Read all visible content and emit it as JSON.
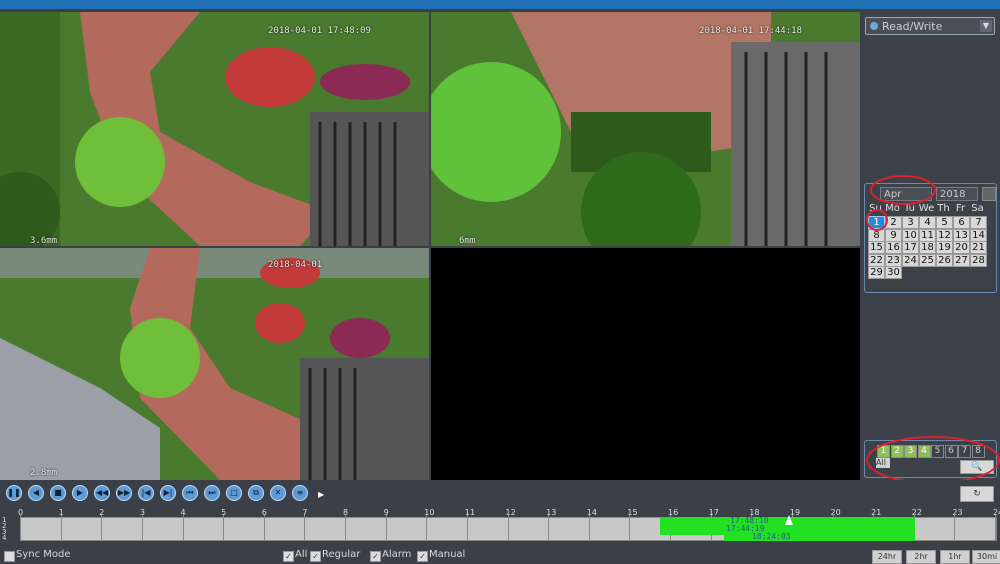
{
  "cameras": [
    {
      "id": "cam1",
      "timestamp": "2018-04-01 17:48:09",
      "lens": "3.6mm"
    },
    {
      "id": "cam2",
      "timestamp": "2018-04-01 17:44:18",
      "lens": "6mm"
    },
    {
      "id": "cam3",
      "timestamp": "2018-04-01",
      "lens": "2.8mm"
    }
  ],
  "mode": {
    "value": "Read/Write"
  },
  "calendar": {
    "month": "Apr",
    "year": "2018",
    "days_of_week": [
      "Su",
      "Mo",
      "Tu",
      "We",
      "Th",
      "Fr",
      "Sa"
    ],
    "days": [
      "1",
      "2",
      "3",
      "4",
      "5",
      "6",
      "7",
      "8",
      "9",
      "10",
      "11",
      "12",
      "13",
      "14",
      "15",
      "16",
      "17",
      "18",
      "19",
      "20",
      "21",
      "22",
      "23",
      "24",
      "25",
      "26",
      "27",
      "28",
      "29",
      "30"
    ],
    "selected_day": "1"
  },
  "channels": {
    "items": [
      "1",
      "2",
      "3",
      "4",
      "5",
      "6",
      "7",
      "8"
    ],
    "enabled": [
      "1",
      "2",
      "3",
      "4"
    ],
    "all_label": "All"
  },
  "playback_buttons": [
    "pause-icon",
    "rewind-icon",
    "stop-icon",
    "play-icon",
    "slow-icon",
    "fast-icon",
    "prev-frame-icon",
    "next-frame-icon",
    "prev-file-icon",
    "next-file-icon",
    "clip-icon",
    "backup-icon",
    "fullscreen-icon",
    "list-icon"
  ],
  "timeline": {
    "hours": [
      "0",
      "1",
      "2",
      "3",
      "4",
      "5",
      "6",
      "7",
      "8",
      "9",
      "10",
      "11",
      "12",
      "13",
      "14",
      "15",
      "16",
      "17",
      "18",
      "19",
      "20",
      "21",
      "22",
      "23",
      "24"
    ],
    "channel_labels": [
      "1",
      "2",
      "3",
      "4"
    ],
    "record_labels": [
      "17:48:10",
      "17:44:19",
      "18:24:03"
    ]
  },
  "options": {
    "sync_mode": "Sync Mode",
    "filters": [
      "All",
      "Regular",
      "Alarm",
      "Manual"
    ],
    "zoom": [
      "24hr",
      "2hr",
      "1hr",
      "30mi"
    ]
  },
  "colors": {
    "selected_day": "#2a8ad8",
    "record": "#22e022",
    "annotation": "#e0202a"
  }
}
